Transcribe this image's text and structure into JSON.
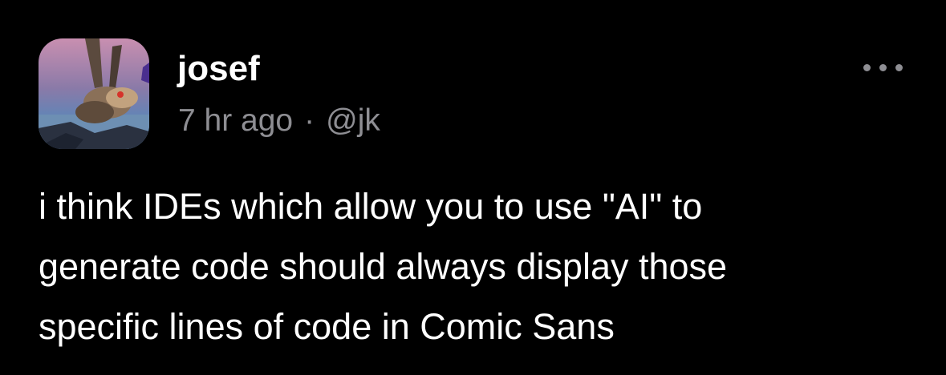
{
  "post": {
    "author": {
      "display_name": "josef",
      "handle": "@jk",
      "avatar": "avatar-image"
    },
    "timestamp": "7 hr ago",
    "separator": "·",
    "more_menu_icon": "more-horizontal-icon",
    "body_lines": [
      "i think IDEs which allow you to use \"AI\" to",
      "generate code should always display those",
      "specific lines of code in Comic Sans"
    ]
  },
  "colors": {
    "background": "#000000",
    "primary_text": "#ffffff",
    "secondary_text": "#8e8e93"
  }
}
